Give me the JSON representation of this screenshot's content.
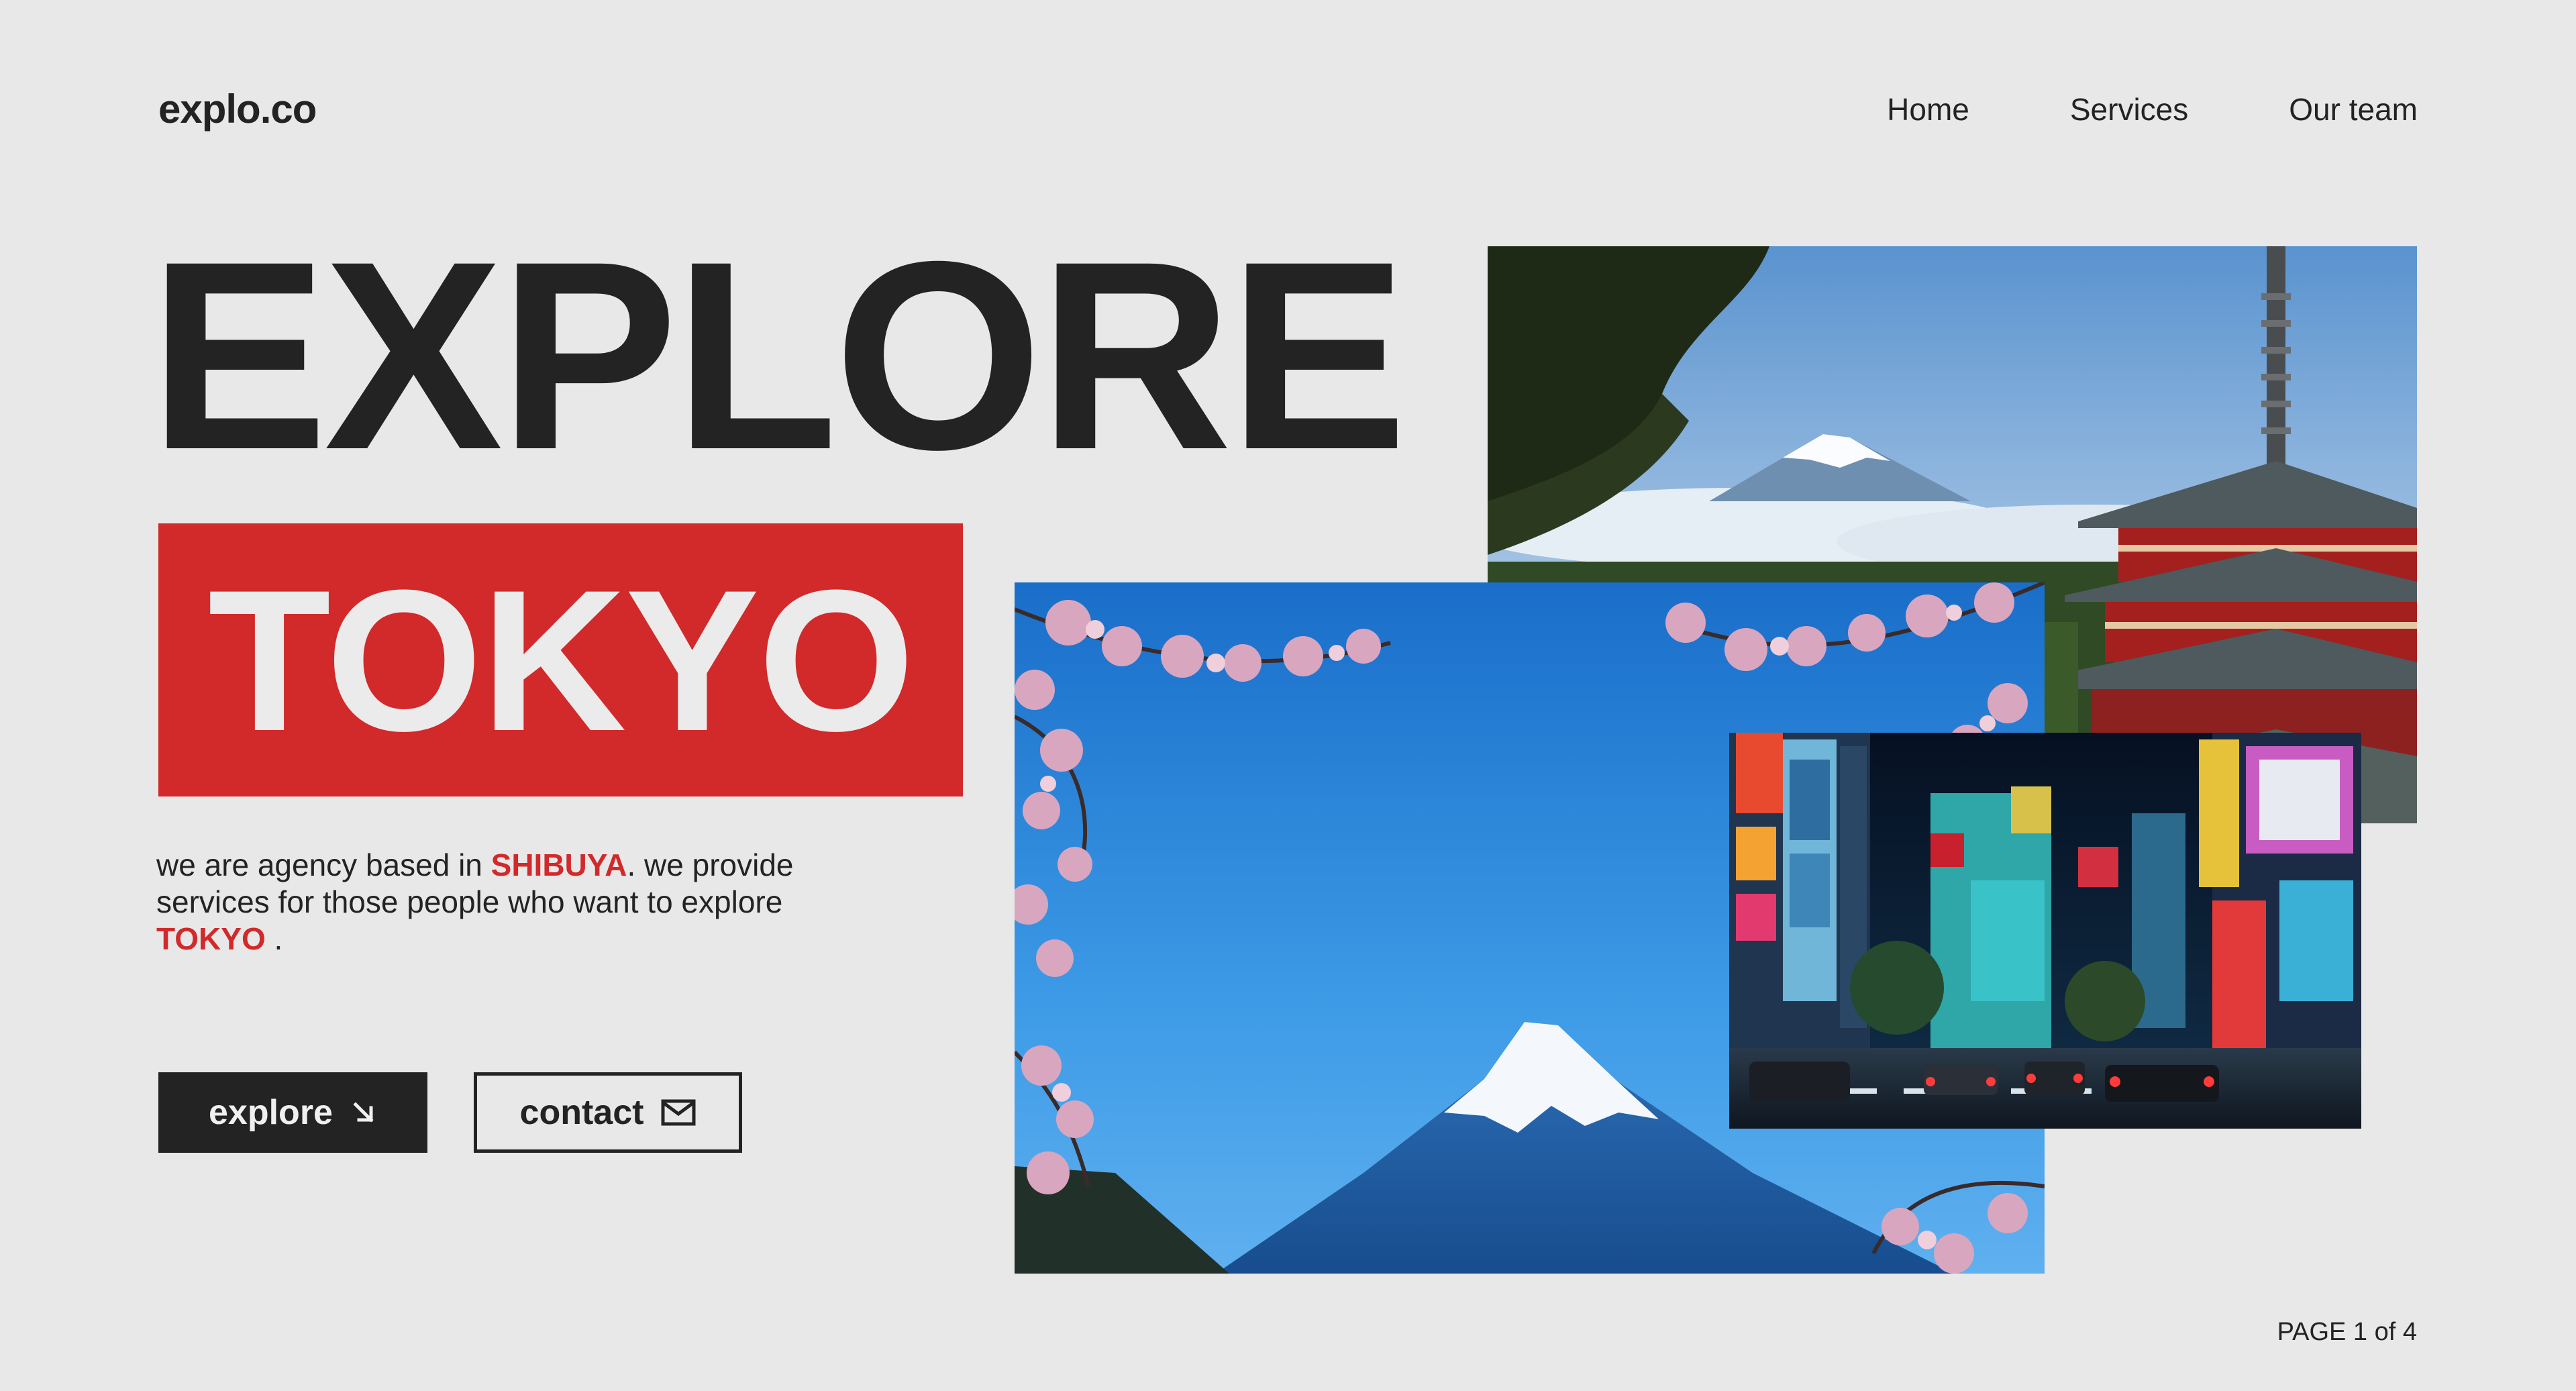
{
  "brand": "explo.co",
  "nav": {
    "home": "Home",
    "services": "Services",
    "our_team": "Our team"
  },
  "hero": {
    "title_line1": "EXPLORE",
    "title_line2": "TOKYO"
  },
  "description": {
    "part1": "we are agency based in ",
    "highlight1": "SHIBUYA",
    "part2": ". we provide services for those people who want to explore ",
    "highlight2": "TOKYO",
    "part3": " ."
  },
  "buttons": {
    "explore_label": "explore",
    "explore_icon": "arrow-down-right-icon",
    "contact_label": "contact",
    "contact_icon": "mail-icon"
  },
  "images": {
    "photo1": "mount-fuji-pagoda-photo",
    "photo2": "mount-fuji-cherry-blossom-photo",
    "photo3": "shibuya-night-street-photo"
  },
  "pagination": "PAGE 1 of 4",
  "colors": {
    "background": "#e8e8e8",
    "accent_red": "#d2292b",
    "dark": "#232323"
  }
}
